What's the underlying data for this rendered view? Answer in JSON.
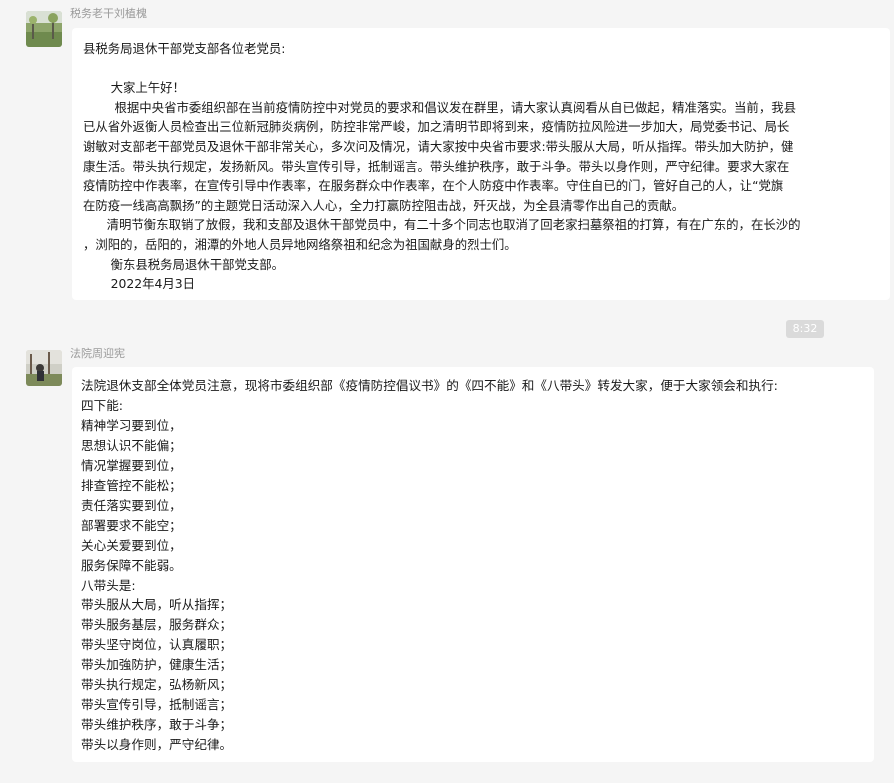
{
  "messages": [
    {
      "sender": "税务老干刘植槐",
      "lines": [
        "县税务局退休干部党支部各位老党员:",
        "",
        "       大家上午好！",
        "        根据中央省市委组织部在当前疫情防控中对党员的要求和倡议发在群里，请大家认真阅看从自已做起，精准落实。当前，我县",
        "已从省外返衡人员检查出三位新冠肺炎病例，防控非常严峻，加之清明节即将到来，疫情防拉风险进一步加大，局党委书记、局长",
        "谢敏对支部老干部党员及退休干部非常关心，多次问及情况，请大家按中央省市要求:带头服从大局，听从指挥。带头加大防护，健",
        "康生活。带头执行规定，发扬新风。带头宣传引导，抵制谣言。带头维护秩序，敢于斗争。带头以身作则，严守纪律。要求大家在",
        "疫情防控中作表率，在宣传引导中作表率，在服务群众中作表率，在个人防疫中作表率。守住自已的门，管好自己的人，让“党旗",
        "在防疫一线高高飘扬”的主题党日活动深入人心，全力打赢防控阻击战，歼灭战，为全县清零作出自己的贡献。",
        "      清明节衡东取销了放假，我和支部及退休干部党员中，有二十多个同志也取消了回老家扫墓祭祖的打算，有在广东的，在长沙的",
        "，浏阳的，岳阳的，湘潭的外地人员异地网络祭祖和纪念为祖国献身的烈士们。",
        "       衡东县税务局退休干部党支部。",
        "       2022年4月3日"
      ]
    },
    {
      "sender": "法院周迎宪",
      "lines": [
        "法院退休支部全体党员注意，现将市委组织部《疫情防控倡议书》的《四不能》和《八带头》转发大家，便于大家领会和执行:",
        "四下能:",
        "精神学习要到位，",
        "思想认识不能偏；",
        "情况掌握要到位，",
        "排查管控不能松；",
        "责任落实要到位，",
        "部署要求不能空；",
        "关心关爱要到位，",
        "服务保障不能弱。",
        "八带头是:",
        "带头服从大局，听从指挥；",
        "带头服务基层，服务群众；",
        "带头坚守岗位，认真履职；",
        "带头加強防护，健康生活；",
        "带头执行规定，弘杨新风；",
        "带头宣传引导，抵制谣言；",
        "带头维护秩序，敢于斗争；",
        "带头以身作则，严守纪律。"
      ]
    }
  ],
  "time_divider": "8:32"
}
